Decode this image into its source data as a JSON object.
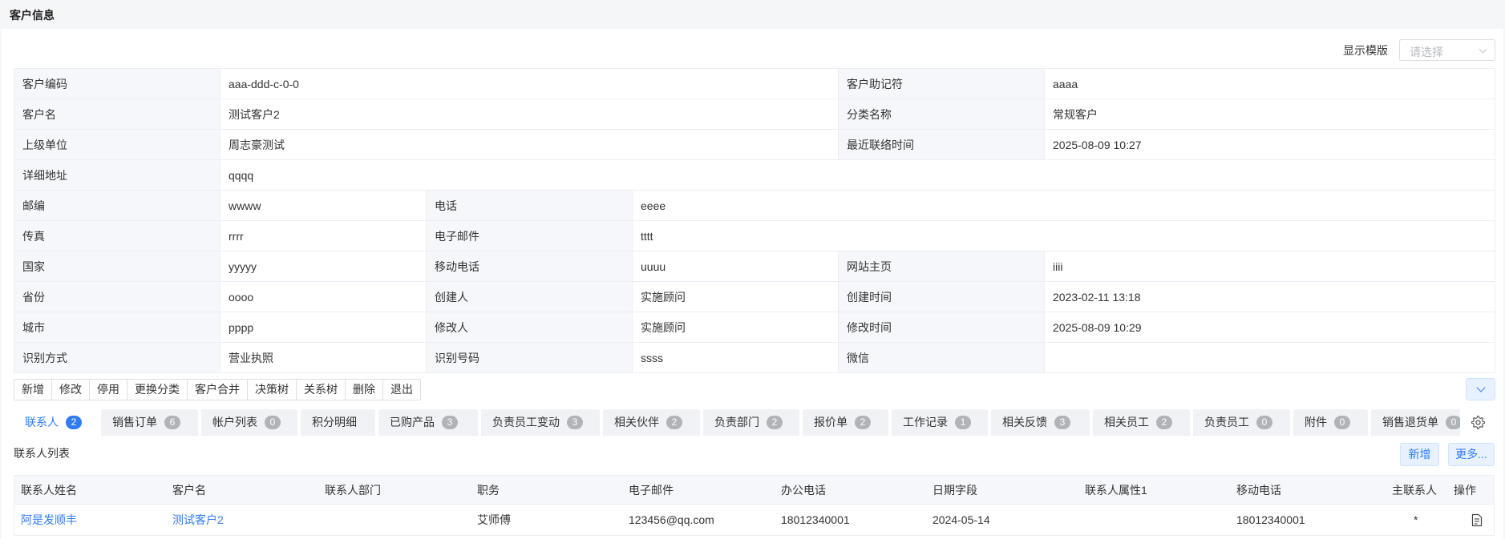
{
  "page": {
    "title": "客户信息"
  },
  "template_select": {
    "label": "显示模版",
    "placeholder": "请选择"
  },
  "info_rows": [
    [
      {
        "label": "客户编码",
        "value": "aaa-ddd-c-0-0"
      },
      {
        "label": "客户助记符",
        "value": "aaaa"
      }
    ],
    [
      {
        "label": "客户名",
        "value": "测试客户2"
      },
      {
        "label": "分类名称",
        "value": "常规客户"
      }
    ],
    [
      {
        "label": "上级单位",
        "value": "周志豪测试"
      },
      {
        "label": "最近联络时间",
        "value": "2025-08-09 10:27"
      }
    ],
    [
      {
        "label": "详细地址",
        "value": "qqqq"
      }
    ],
    [
      {
        "label": "邮编",
        "value": "wwww"
      },
      {
        "label": "电话",
        "value": "eeee"
      }
    ],
    [
      {
        "label": "传真",
        "value": "rrrr"
      },
      {
        "label": "电子邮件",
        "value": "tttt"
      }
    ],
    [
      {
        "label": "国家",
        "value": "yyyyy"
      },
      {
        "label": "移动电话",
        "value": "uuuu"
      },
      {
        "label": "网站主页",
        "value": "iiii"
      }
    ],
    [
      {
        "label": "省份",
        "value": "oooo"
      },
      {
        "label": "创建人",
        "value": "实施顾问"
      },
      {
        "label": "创建时间",
        "value": "2023-02-11 13:18"
      }
    ],
    [
      {
        "label": "城市",
        "value": "pppp"
      },
      {
        "label": "修改人",
        "value": "实施顾问"
      },
      {
        "label": "修改时间",
        "value": "2025-08-09 10:29"
      }
    ],
    [
      {
        "label": "识别方式",
        "value": "营业执照"
      },
      {
        "label": "识别号码",
        "value": "ssss"
      },
      {
        "label": "微信",
        "value": ""
      }
    ]
  ],
  "actions": [
    "新增",
    "修改",
    "停用",
    "更换分类",
    "客户合并",
    "决策树",
    "关系树",
    "删除",
    "退出"
  ],
  "tabs": [
    {
      "label": "联系人",
      "count": "2"
    },
    {
      "label": "销售订单",
      "count": "6"
    },
    {
      "label": "帐户列表",
      "count": "0"
    },
    {
      "label": "积分明细",
      "count": ""
    },
    {
      "label": "已购产品",
      "count": "3"
    },
    {
      "label": "负责员工变动",
      "count": "3"
    },
    {
      "label": "相关伙伴",
      "count": "2"
    },
    {
      "label": "负责部门",
      "count": "2"
    },
    {
      "label": "报价单",
      "count": "2"
    },
    {
      "label": "工作记录",
      "count": "1"
    },
    {
      "label": "相关反馈",
      "count": "3"
    },
    {
      "label": "相关员工",
      "count": "2"
    },
    {
      "label": "负责员工",
      "count": "0"
    },
    {
      "label": "附件",
      "count": "0"
    },
    {
      "label": "销售退货单",
      "count": "0"
    }
  ],
  "contacts": {
    "title": "联系人列表",
    "add_label": "新增",
    "more_label": "更多...",
    "columns": [
      "联系人姓名",
      "客户名",
      "联系人部门",
      "职务",
      "电子邮件",
      "办公电话",
      "日期字段",
      "联系人属性1",
      "移动电话",
      "主联系人",
      "操作"
    ],
    "rows": [
      {
        "name": "阿是发顺丰",
        "customer": "测试客户2",
        "dept": "",
        "title": "艾师傅",
        "email": "123456@qq.com",
        "office_phone": "18012340001",
        "date": "2024-05-14",
        "attr1": "",
        "mobile": "18012340001",
        "primary": "*"
      }
    ]
  },
  "colors": {
    "accent": "#2f7cf6",
    "label_bg": "#f5f7fa",
    "border": "#ebeef5"
  }
}
